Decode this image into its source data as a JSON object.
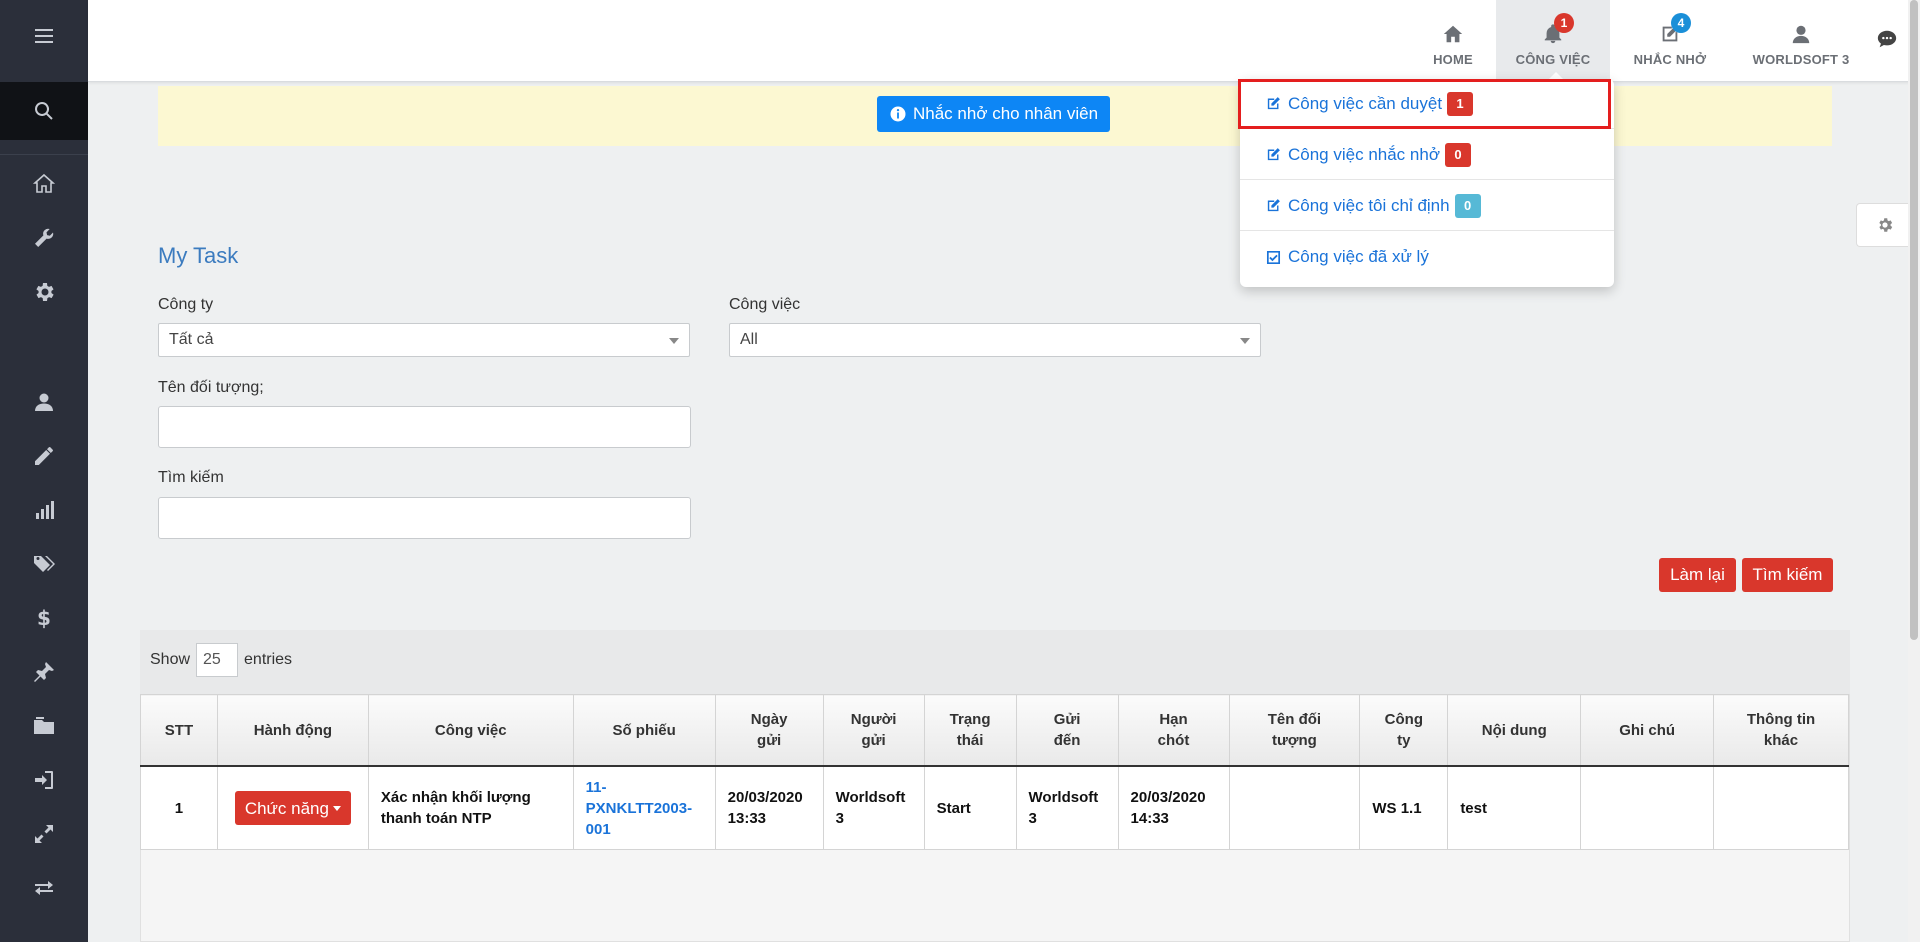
{
  "topnav": {
    "items": [
      {
        "label": "HOME",
        "icon": "home-icon",
        "badge": null
      },
      {
        "label": "CÔNG VIỆC",
        "icon": "bell-icon",
        "badge": "1"
      },
      {
        "label": "NHẮC NHỞ",
        "icon": "edit-icon",
        "badge": "4"
      },
      {
        "label": "WORLDSOFT 3",
        "icon": "user-icon",
        "badge": null
      }
    ],
    "chat_icon": "chat-icon"
  },
  "sidebar": {
    "icons": [
      "menu-icon",
      "search-icon",
      "home-icon",
      "wrench-icon",
      "gear-icon",
      "user-icon",
      "pencil-icon",
      "bar-chart-icon",
      "tags-icon",
      "dollar-icon",
      "pin-icon",
      "folder-icon",
      "sign-in-icon",
      "expand-icon",
      "exchange-icon"
    ]
  },
  "banner": {
    "button_label": "Nhắc nhở cho nhân viên"
  },
  "dropdown": {
    "items": [
      {
        "label": "Công việc cần duyệt",
        "badge": "1",
        "badge_color": "#d9372c"
      },
      {
        "label": "Công việc nhắc nhở",
        "badge": "0",
        "badge_color": "#d9372c"
      },
      {
        "label": "Công việc tôi chỉ định",
        "badge": "0",
        "badge_color": "#56b9d6"
      },
      {
        "label": "Công việc đã xử lý",
        "badge": null
      }
    ]
  },
  "form": {
    "title": "My Task",
    "company_label": "Công ty",
    "company_value": "Tất cả",
    "task_label": "Công việc",
    "task_value": "All",
    "object_label": "Tên đối tượng;",
    "object_value": "",
    "search_label": "Tìm kiếm",
    "search_value": "",
    "reset_button": "Làm lại",
    "search_button": "Tìm kiếm"
  },
  "table": {
    "show_label": "Show",
    "page_size": "25",
    "entries_label": "entries",
    "columns": [
      [
        "STT"
      ],
      [
        "Hành động"
      ],
      [
        "Công việc"
      ],
      [
        "Số phiếu"
      ],
      [
        "Ngày",
        "gửi"
      ],
      [
        "Người",
        "gửi"
      ],
      [
        "Trạng",
        "thái"
      ],
      [
        "Gửi",
        "đến"
      ],
      [
        "Hạn",
        "chót"
      ],
      [
        "Tên đối",
        "tượng"
      ],
      [
        "Công",
        "ty"
      ],
      [
        "Nội dung"
      ],
      [
        "Ghi chú"
      ],
      [
        "Thông tin",
        "khác"
      ]
    ],
    "rows": [
      {
        "stt": "1",
        "action": "Chức năng",
        "task": [
          "Xác nhận khối lượng",
          "thanh toán NTP"
        ],
        "ticket": [
          "11-",
          "PXNKLTT2003-",
          "001"
        ],
        "sent_date": [
          "20/03/2020",
          "13:33"
        ],
        "sender": [
          "Worldsoft",
          "3"
        ],
        "status": "Start",
        "sent_to": [
          "Worldsoft",
          "3"
        ],
        "deadline": [
          "20/03/2020",
          "14:33"
        ],
        "object_name": "",
        "company": "WS 1.1",
        "content": "test",
        "note": "",
        "other": ""
      }
    ]
  },
  "colors": {
    "sidebar": "#2b2f3a",
    "accent_red": "#d9372c",
    "link_blue": "#1a73d9",
    "banner_bg": "#fcf8d2",
    "highlight": "#e41e1e"
  }
}
